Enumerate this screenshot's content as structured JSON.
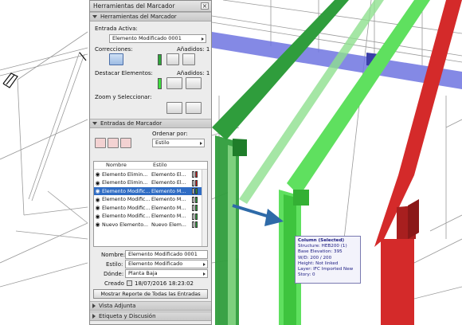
{
  "palette": {
    "window_title": "Herramientas del Marcador",
    "close_glyph": "×",
    "section_tools": "Herramientas del Marcador",
    "active_entry_label": "Entrada Activa:",
    "active_entry_value": "Elemento Modificado 0001",
    "corrections_label": "Correcciones:",
    "added_label_1": "Añadidos: 1",
    "highlight_label": "Destacar Elementos:",
    "added_label_2": "Añadidos: 1",
    "zoom_label": "Zoom y Seleccionar:",
    "section_entries": "Entradas de Marcador",
    "sort_by_label": "Ordenar por:",
    "sort_by_value": "Estilo",
    "col_name": "Nombre",
    "col_style": "Estilo",
    "rows": [
      {
        "name": "Elemento Elimin...",
        "style": "Elemento El...",
        "colors": [
          "#ffffff",
          "#d62020"
        ],
        "selected": false
      },
      {
        "name": "Elemento Elimin...",
        "style": "Elemento El...",
        "colors": [
          "#ffffff",
          "#d62020"
        ],
        "selected": false
      },
      {
        "name": "Elemento Modific...",
        "style": "Elemento M...",
        "colors": [
          "#ffffff",
          "#29a83a"
        ],
        "selected": true
      },
      {
        "name": "Elemento Modific...",
        "style": "Elemento M...",
        "colors": [
          "#ffffff",
          "#29a83a"
        ],
        "selected": false
      },
      {
        "name": "Elemento Modific...",
        "style": "Elemento M...",
        "colors": [
          "#ffffff",
          "#29a83a"
        ],
        "selected": false
      },
      {
        "name": "Elemento Modific...",
        "style": "Elemento M...",
        "colors": [
          "#ffffff",
          "#29a83a"
        ],
        "selected": false
      },
      {
        "name": "Nuevo Elemento...",
        "style": "Nuevo Elem...",
        "colors": [
          "#ffffff",
          "#29a83a"
        ],
        "selected": false
      }
    ],
    "name_label": "Nombre:",
    "name_value": "Elemento Modificado 0001",
    "style_label": "Estilo:",
    "style_value": "Elemento Modificado",
    "where_label": "Dónde:",
    "where_value": "Planta Baja",
    "created_label": "Creado",
    "created_value": "18/07/2016 18:23:02",
    "report_button": "Mostrar Reporte de Todas las Entradas",
    "section_attached": "Vista Adjunta",
    "section_label": "Etiqueta y Discusión"
  },
  "tooltip": {
    "title": "Column (Selected)",
    "lines": [
      "Structure: HEB200 (1)",
      "Base Elevation: 395",
      "W/D: 200 / 200",
      "Height: Not linked",
      "Layer: IFC Imported New",
      "Story: 0"
    ]
  },
  "colors": {
    "green_highlight": "#5fe05f",
    "green_dark": "#2f9d3c",
    "red_highlight": "#d42a2a",
    "blue_beam": "#6f74e0",
    "selection_blue": "#2f6cc4"
  },
  "icons": [
    "eye-icon",
    "zoom-icon",
    "select-icon",
    "correction-icon",
    "highlight-icon"
  ]
}
